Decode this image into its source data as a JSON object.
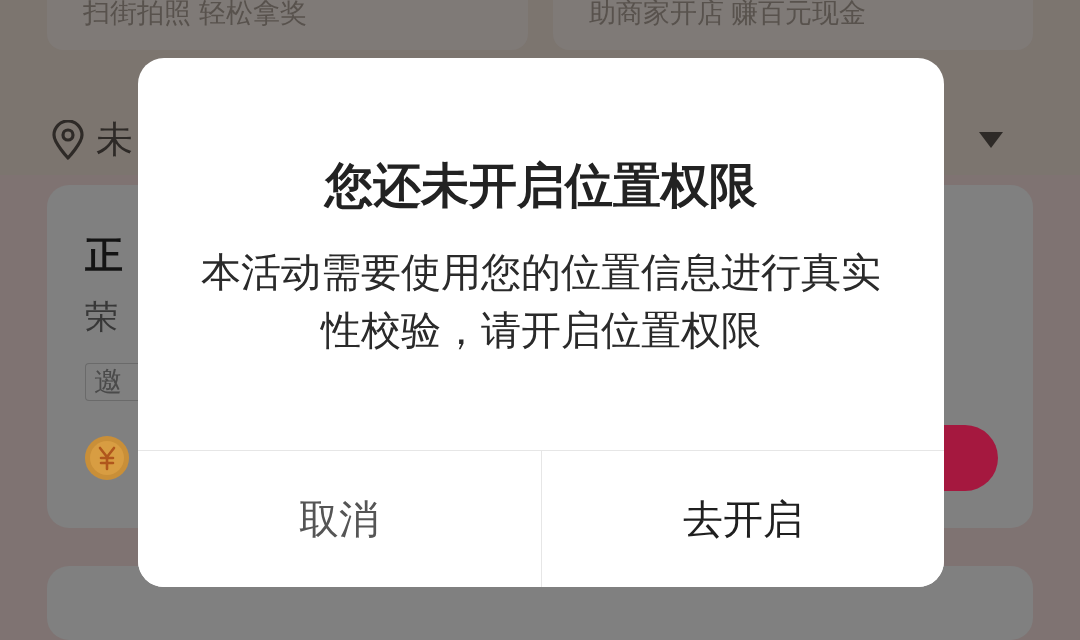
{
  "background": {
    "promo_cards": [
      {
        "text": "扫街拍照 轻松拿奖"
      },
      {
        "text": "助商家开店 赚百元现金"
      }
    ],
    "location_bar": {
      "location": "未"
    },
    "merchant_card": {
      "title": "正",
      "subtitle": "荣",
      "tag": "邀"
    }
  },
  "dialog": {
    "title": "您还未开启位置权限",
    "message": "本活动需要使用您的位置信息进行真实性校验，请开启位置权限",
    "buttons": [
      {
        "label": "取消",
        "kind": "cancel"
      },
      {
        "label": "去开启",
        "kind": "confirm"
      }
    ]
  }
}
